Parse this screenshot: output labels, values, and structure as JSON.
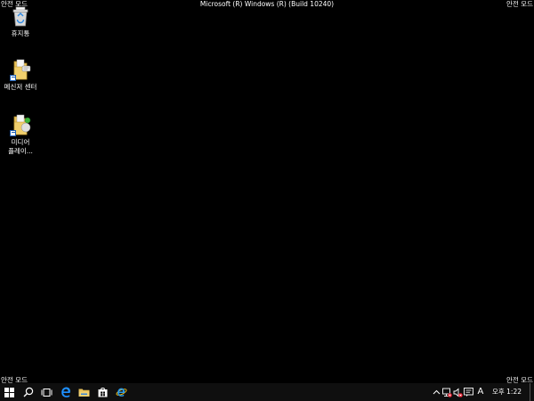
{
  "screen": {
    "title": "Microsoft (R) Windows (R) (Build 10240)",
    "safe_mode_top_left": "안전 모드",
    "safe_mode_top_right": "안전 모드",
    "safe_mode_bottom_left": "안전 모드",
    "safe_mode_bottom_right": "안전 모드",
    "background_color": "#000000"
  },
  "desktop_icons": [
    {
      "label": "휴지통",
      "icon": "recycle-bin-icon"
    },
    {
      "label": "메신저 센터",
      "icon": "messenger-folder-icon"
    },
    {
      "label": "미디어 플레이...",
      "icon": "media-player-folder-icon"
    }
  ],
  "taskbar": {
    "pinned": [
      {
        "name": "start",
        "icon": "windows-start-icon"
      },
      {
        "name": "search",
        "icon": "search-icon"
      },
      {
        "name": "task-view",
        "icon": "task-view-icon"
      },
      {
        "name": "edge",
        "icon": "edge-icon"
      },
      {
        "name": "file-explorer",
        "icon": "file-explorer-icon"
      },
      {
        "name": "store",
        "icon": "store-icon"
      },
      {
        "name": "internet-explorer",
        "icon": "internet-explorer-icon"
      }
    ],
    "tray": {
      "chevron_icon": "chevron-up-icon",
      "network_icon": "network-disconnected-icon",
      "volume_icon": "volume-muted-icon",
      "action_center_icon": "action-center-icon",
      "ime_label": "A",
      "time": "오후 1:22"
    }
  },
  "colors": {
    "accent_blue": "#1e90ff",
    "taskbar": "#0f0f0f",
    "folder_yellow": "#e8c15a",
    "error_red": "#e81123"
  }
}
